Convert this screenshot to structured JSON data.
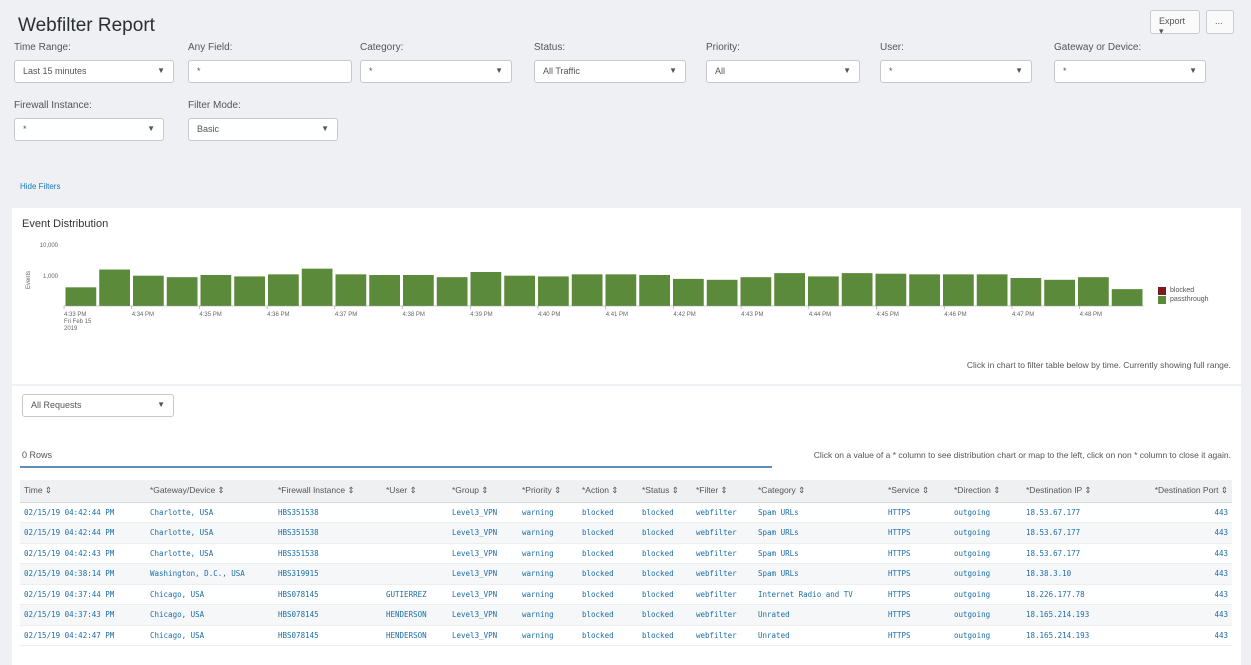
{
  "header": {
    "title": "Webfilter Report",
    "export_label": "Export ▾",
    "more_label": "..."
  },
  "filters": {
    "time_range": {
      "label": "Time Range:",
      "value": "Last 15 minutes"
    },
    "any_field": {
      "label": "Any Field:",
      "value": "*"
    },
    "category": {
      "label": "Category:",
      "value": "*"
    },
    "status": {
      "label": "Status:",
      "value": "All Traffic"
    },
    "priority": {
      "label": "Priority:",
      "value": "All"
    },
    "user": {
      "label": "User:",
      "value": "*"
    },
    "gateway": {
      "label": "Gateway or Device:",
      "value": "*"
    },
    "firewall": {
      "label": "Firewall Instance:",
      "value": "*"
    },
    "filter_mode": {
      "label": "Filter Mode:",
      "value": "Basic"
    },
    "hide_filters": "Hide Filters"
  },
  "chart_panel": {
    "title": "Event Distribution",
    "note": "Click in chart to filter table below by time. Currently showing full range.",
    "legend": [
      {
        "name": "blocked",
        "color": "#7a1c1c"
      },
      {
        "name": "passthrough",
        "color": "#5a8a3a"
      }
    ]
  },
  "chart_data": {
    "type": "bar",
    "ylabel": "Events",
    "yticks": [
      "10,000",
      "1,000"
    ],
    "ylim": [
      100,
      10000
    ],
    "yscale": "log",
    "xticks": [
      "4:33 PM\nFri Feb 15\n2019",
      "4:34 PM",
      "4:35 PM",
      "4:36 PM",
      "4:37 PM",
      "4:38 PM",
      "4:39 PM",
      "4:40 PM",
      "4:41 PM",
      "4:42 PM",
      "4:43 PM",
      "4:44 PM",
      "4:45 PM",
      "4:46 PM",
      "4:47 PM",
      "4:48 PM"
    ],
    "series": [
      {
        "name": "passthrough",
        "color": "#5a8a3a",
        "values": [
          400,
          1500,
          950,
          850,
          1000,
          900,
          1050,
          1600,
          1050,
          1000,
          1000,
          850,
          1250,
          950,
          900,
          1050,
          1050,
          1000,
          750,
          700,
          850,
          1150,
          900,
          1150,
          1100,
          1050,
          1050,
          1050,
          800,
          700,
          850,
          350
        ]
      },
      {
        "name": "blocked",
        "color": "#7a1c1c",
        "values": [
          0,
          0,
          0,
          0,
          0,
          0,
          0,
          0,
          0,
          0,
          0,
          0,
          0,
          0,
          0,
          0,
          0,
          0,
          0,
          0,
          0,
          0,
          0,
          0,
          0,
          0,
          0,
          0,
          0,
          0,
          0,
          0
        ]
      }
    ]
  },
  "requests_select": {
    "value": "All Requests"
  },
  "table": {
    "rows_count": "0 Rows",
    "note": "Click on a value of a * column to see distribution chart or map to the left, click on non * column to close it again.",
    "columns": [
      "Time ⇕",
      "*Gateway/Device ⇕",
      "*Firewall Instance ⇕",
      "*User ⇕",
      "*Group ⇕",
      "*Priority ⇕",
      "*Action ⇕",
      "*Status ⇕",
      "*Filter ⇕",
      "*Category ⇕",
      "*Service ⇕",
      "*Direction ⇕",
      "*Destination IP ⇕",
      "*Destination Port ⇕"
    ],
    "rows": [
      [
        "02/15/19 04:42:44 PM",
        "Charlotte, USA",
        "HBS351538",
        "",
        "Level3_VPN",
        "warning",
        "blocked",
        "blocked",
        "webfilter",
        "Spam URLs",
        "HTTPS",
        "outgoing",
        "18.53.67.177",
        "443"
      ],
      [
        "02/15/19 04:42:44 PM",
        "Charlotte, USA",
        "HBS351538",
        "",
        "Level3_VPN",
        "warning",
        "blocked",
        "blocked",
        "webfilter",
        "Spam URLs",
        "HTTPS",
        "outgoing",
        "18.53.67.177",
        "443"
      ],
      [
        "02/15/19 04:42:43 PM",
        "Charlotte, USA",
        "HBS351538",
        "",
        "Level3_VPN",
        "warning",
        "blocked",
        "blocked",
        "webfilter",
        "Spam URLs",
        "HTTPS",
        "outgoing",
        "18.53.67.177",
        "443"
      ],
      [
        "02/15/19 04:38:14 PM",
        "Washington, D.C., USA",
        "HBS319915",
        "",
        "Level3_VPN",
        "warning",
        "blocked",
        "blocked",
        "webfilter",
        "Spam URLs",
        "HTTPS",
        "outgoing",
        "18.38.3.10",
        "443"
      ],
      [
        "02/15/19 04:37:44 PM",
        "Chicago, USA",
        "HBS078145",
        "GUTIERREZ",
        "Level3_VPN",
        "warning",
        "blocked",
        "blocked",
        "webfilter",
        "Internet Radio and TV",
        "HTTPS",
        "outgoing",
        "18.226.177.78",
        "443"
      ],
      [
        "02/15/19 04:37:43 PM",
        "Chicago, USA",
        "HBS078145",
        "HENDERSON",
        "Level3_VPN",
        "warning",
        "blocked",
        "blocked",
        "webfilter",
        "Unrated",
        "HTTPS",
        "outgoing",
        "18.165.214.193",
        "443"
      ],
      [
        "02/15/19 04:42:47 PM",
        "Chicago, USA",
        "HBS078145",
        "HENDERSON",
        "Level3_VPN",
        "warning",
        "blocked",
        "blocked",
        "webfilter",
        "Unrated",
        "HTTPS",
        "outgoing",
        "18.165.214.193",
        "443"
      ]
    ]
  }
}
